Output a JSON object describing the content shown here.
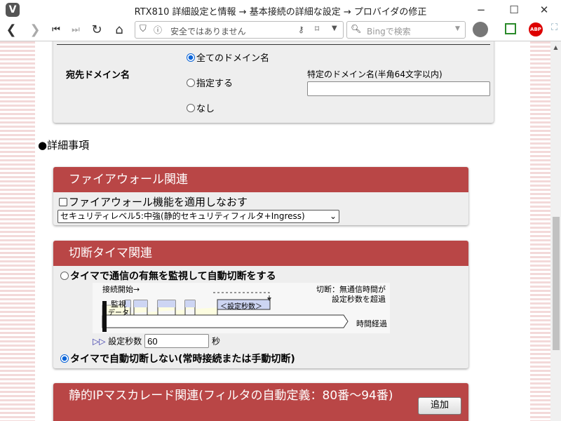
{
  "browser": {
    "title": "RTX810 詳細設定と情報 → 基本接続の詳細な設定 → プロバイダの修正",
    "url_text": "安全ではありません",
    "search_placeholder": "Bingで検索",
    "logo": "V",
    "abp": "ABP"
  },
  "domain_section": {
    "label": "宛先ドメイン名",
    "options": [
      "全てのドメイン名",
      "指定する",
      "なし"
    ],
    "selected": 0,
    "specific_label": "特定のドメイン名(半角64文字以内)",
    "specific_value": ""
  },
  "details_heading": "●詳細事項",
  "firewall": {
    "title": "ファイアウォール関連",
    "checkbox_label": "ファイアウォール機能を適用しなおす",
    "checked": false,
    "level_select": "セキュリティレベル5:中強(静的セキュリティフィルタ+Ingress)"
  },
  "timer": {
    "title": "切断タイマ関連",
    "option_monitor": "タイマで通信の有無を監視して自動切断をする",
    "diagram": {
      "start": "接続開始→",
      "monitor": "監視",
      "data": "データ",
      "cut1": "切断：無通信時間が",
      "cut2": "設定秒数を超過",
      "setsec": "＜設定秒数＞",
      "elapsed": "時間経過"
    },
    "seconds_label": "設定秒数",
    "seconds_value": "60",
    "seconds_unit": "秒",
    "option_none": "タイマで自動切断しない(常時接続または手動切断)",
    "selected": "none"
  },
  "masquerade": {
    "title": "静的IPマスカレード関連(フィルタの自動定義：80番〜94番)",
    "add_button": "追加"
  }
}
